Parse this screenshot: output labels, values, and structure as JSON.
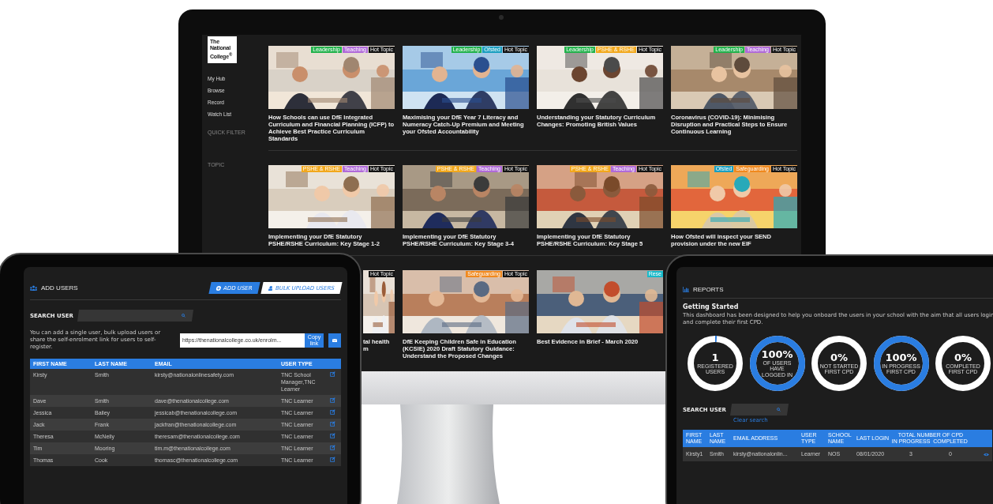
{
  "monitor": {
    "logo": [
      "The",
      "National",
      "College$^{®}$"
    ],
    "nav": [
      {
        "label": "My Hub"
      },
      {
        "label": "Browse"
      },
      {
        "label": "Record"
      },
      {
        "label": "Watch List"
      }
    ],
    "filter_headings": [
      "QUICK FILTER",
      "TOPIC"
    ],
    "rows": [
      [
        {
          "kind": "full",
          "title": "How Schools can use DfE Integrated Curriculum and Financial Planning (ICFP) to Achieve Best Practice Curriculum Standards",
          "tags": [
            {
              "label": "Leadership",
              "color": "#22b24c"
            },
            {
              "label": "Teaching",
              "color": "#b06ad9"
            },
            {
              "label": "Hot Topic",
              "color": "#111111"
            }
          ]
        },
        {
          "kind": "full",
          "title": "Maximising your DfE Year 7 Literacy and Numeracy Catch-Up Premium and Meeting your Ofsted Accountability",
          "tags": [
            {
              "label": "Leadership",
              "color": "#22b24c"
            },
            {
              "label": "Ofsted",
              "color": "#1a9fc0"
            },
            {
              "label": "Hot Topic",
              "color": "#111111"
            }
          ]
        },
        {
          "kind": "full",
          "title": "Understanding your Statutory Curriculum Changes: Promoting British Values",
          "tags": [
            {
              "label": "Leadership",
              "color": "#22b24c"
            },
            {
              "label": "PSHE & RSHE",
              "color": "#f2a81c"
            },
            {
              "label": "Hot Topic",
              "color": "#111111"
            }
          ]
        },
        {
          "kind": "full",
          "title": "Coronavirus (COVID-19): Minimising Disruption and Practical Steps to Ensure Continuous Learning",
          "tags": [
            {
              "label": "Leadership",
              "color": "#22b24c"
            },
            {
              "label": "Teaching",
              "color": "#b06ad9"
            },
            {
              "label": "Hot Topic",
              "color": "#111111"
            }
          ]
        }
      ],
      [
        {
          "kind": "full",
          "title": "Implementing your DfE Statutory PSHE/RSHE Curriculum: Key Stage 1-2",
          "tags": [
            {
              "label": "PSHE & RSHE",
              "color": "#f2a81c"
            },
            {
              "label": "Teaching",
              "color": "#b06ad9"
            },
            {
              "label": "Hot Topic",
              "color": "#111111"
            }
          ]
        },
        {
          "kind": "full",
          "title": "Implementing your DfE Statutory PSHE/RSHE Curriculum: Key Stage 3-4",
          "tags": [
            {
              "label": "PSHE & RSHE",
              "color": "#f2a81c"
            },
            {
              "label": "Teaching",
              "color": "#b06ad9"
            },
            {
              "label": "Hot Topic",
              "color": "#111111"
            }
          ]
        },
        {
          "kind": "full",
          "title": "Implementing your DfE Statutory PSHE/RSHE Curriculum: Key Stage 5",
          "tags": [
            {
              "label": "PSHE & RSHE",
              "color": "#f2a81c"
            },
            {
              "label": "Teaching",
              "color": "#b06ad9"
            },
            {
              "label": "Hot Topic",
              "color": "#111111"
            }
          ]
        },
        {
          "kind": "full",
          "title": "How Ofsted will inspect your SEND provision under the new EIF",
          "tags": [
            {
              "label": "Ofsted",
              "color": "#1a9fc0"
            },
            {
              "label": "Safeguarding",
              "color": "#f0891e"
            },
            {
              "label": "Hot Topic",
              "color": "#111111"
            }
          ]
        }
      ],
      [
        {
          "kind": "partial",
          "title": "tal health m",
          "tags": [
            {
              "label": "Hot Topic",
              "color": "#111111"
            }
          ]
        },
        {
          "kind": "full",
          "title": "DfE Keeping Children Safe in Education (KCSIE) 2020 Draft Statutory Guidance: Understand the Proposed Changes",
          "tags": [
            {
              "label": "Safeguarding",
              "color": "#f0891e"
            },
            {
              "label": "Hot Topic",
              "color": "#111111"
            }
          ]
        },
        {
          "kind": "full",
          "title": "Best Evidence in Brief - March 2020",
          "tags": [
            {
              "label": "Rese",
              "color": "#17b9c9"
            }
          ]
        }
      ]
    ]
  },
  "add_users": {
    "title": "ADD USERS",
    "buttons": [
      {
        "label": "ADD USER",
        "selected": true
      },
      {
        "label": "BULK UPLOAD USERS",
        "selected": false
      }
    ],
    "search": {
      "label": "SEARCH USER"
    },
    "intro": "You can add a single user, bulk upload users or share the self-enrolment link for users to self-register.",
    "link": {
      "value": "https://thenationalcollege.co.uk/enrolm...",
      "copy": "Copy link"
    },
    "table": {
      "columns": [
        "FIRST NAME",
        "LAST NAME",
        "EMAIL",
        "USER TYPE"
      ],
      "rows": [
        [
          "Kirsty",
          "Smith",
          "kirsty@nationalonlinesafety.com",
          "TNC School Manager,TNC Learner"
        ],
        [
          "Dave",
          "Smith",
          "dave@thenationalcollege.com",
          "TNC Learner"
        ],
        [
          "Jessica",
          "Bailey",
          "jessicab@thenationalcollege.com",
          "TNC Learner"
        ],
        [
          "Jack",
          "Frank",
          "jackfran@thenationalcollege.com",
          "TNC Learner"
        ],
        [
          "Theresa",
          "McNeily",
          "theresam@thenationalcollege.com",
          "TNC Learner"
        ],
        [
          "Tim",
          "Mooring",
          "tim.m@thenationalcollege.com",
          "TNC Learner"
        ],
        [
          "Thomas",
          "Cook",
          "thomasc@thenationalcollege.com",
          "TNC Learner"
        ]
      ]
    }
  },
  "reports": {
    "title": "REPORTS",
    "heading": "Getting Started",
    "intro": "This dashboard has been designed to help you onboard the users in your school with the aim that all users login and complete their first CPD.",
    "stats": [
      {
        "value": "1",
        "label": "REGISTERED USERS",
        "level": 0.01
      },
      {
        "value": "100%",
        "label": "OF USERS HAVE LOGGED IN",
        "level": 1
      },
      {
        "value": "0%",
        "label": "NOT STARTED FIRST CPD",
        "level": 0
      },
      {
        "value": "100%",
        "label": "IN PROGRESS FIRST CPD",
        "level": 1
      },
      {
        "value": "0%",
        "label": "COMPLETED FIRST CPD",
        "level": 0
      }
    ],
    "search": {
      "label": "SEARCH USER",
      "clear": "Clear search"
    },
    "table": {
      "columns": [
        "FIRST NAME",
        "LAST NAME",
        "EMAIL ADDRESS",
        "USER TYPE",
        "SCHOOL NAME",
        "LAST LOGIN"
      ],
      "group": "TOTAL NUMBER OF CPD",
      "subcolumns": [
        "IN PROGRESS",
        "COMPLETED"
      ],
      "rows": [
        [
          "Kirsty1",
          "Smith",
          "kirsty@nationalonlin...",
          "Learner",
          "NOS",
          "08/01/2020",
          "3",
          "0"
        ]
      ]
    }
  }
}
